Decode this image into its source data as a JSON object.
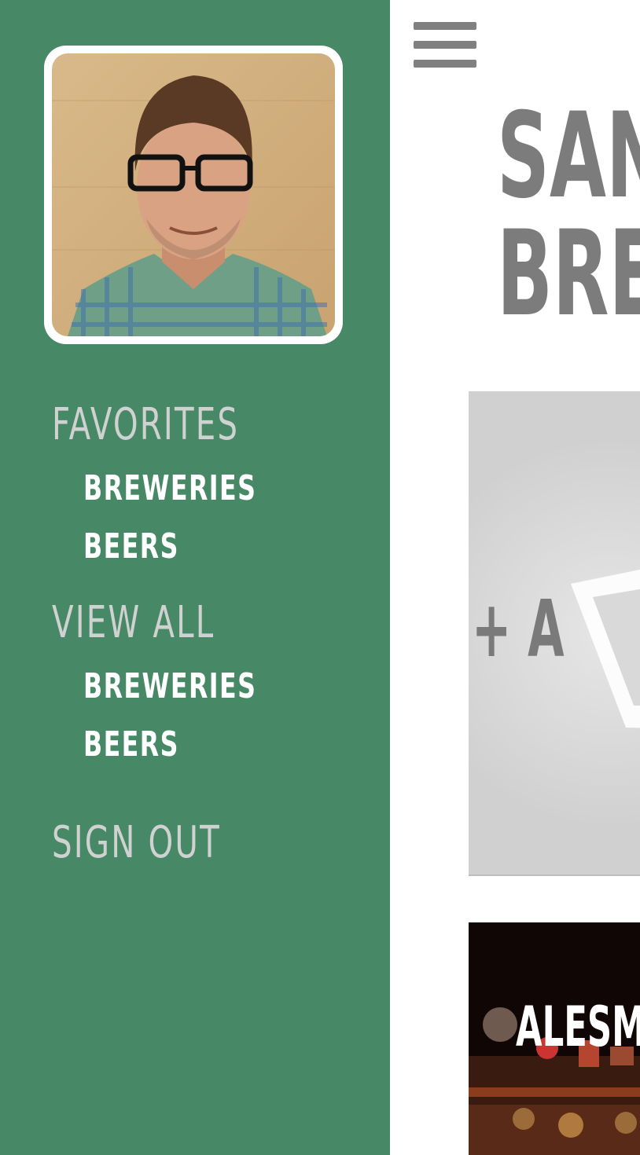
{
  "drawer": {
    "profile_photo_alt": "User profile photo",
    "sections": [
      {
        "heading": "FAVORITES",
        "items": [
          "BREWERIES",
          "BEERS"
        ]
      },
      {
        "heading": "VIEW ALL",
        "items": [
          "BREWERIES",
          "BEERS"
        ]
      }
    ],
    "sign_out": "SIGN OUT"
  },
  "main": {
    "menu_icon": "hamburger-menu-icon",
    "title_line1": "SAN",
    "title_line2": "BRE",
    "add_card_label": "+ A",
    "brewery_card_name": "ALESMI"
  },
  "colors": {
    "drawer_bg": "#478966",
    "heading_text": "#cfd2d0",
    "item_text": "#ffffff",
    "title_gray": "#7c7c7c"
  }
}
